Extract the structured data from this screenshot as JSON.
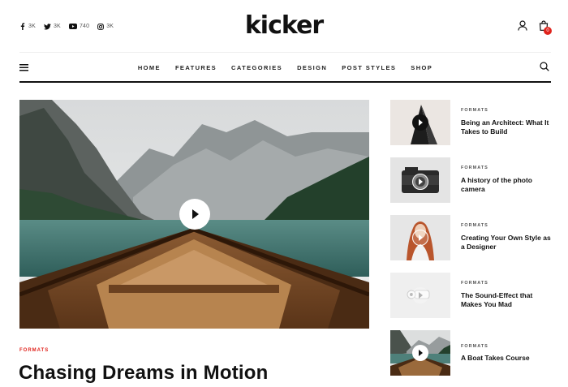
{
  "brand": {
    "logo": "kicker"
  },
  "social": [
    {
      "icon": "facebook-icon",
      "count": "3K"
    },
    {
      "icon": "twitter-icon",
      "count": "3K"
    },
    {
      "icon": "youtube-icon",
      "count": "740"
    },
    {
      "icon": "instagram-icon",
      "count": "3K"
    }
  ],
  "header": {
    "cart_count": "0"
  },
  "nav": {
    "items": [
      {
        "label": "HOME"
      },
      {
        "label": "FEATURES"
      },
      {
        "label": "CATEGORIES"
      },
      {
        "label": "DESIGN"
      },
      {
        "label": "POST STYLES"
      },
      {
        "label": "SHOP"
      }
    ]
  },
  "featured": {
    "category": "FORMATS",
    "title": "Chasing Dreams in Motion",
    "image": "mountain-lake-boat-photo",
    "media": "video"
  },
  "sidebar": {
    "posts": [
      {
        "category": "FORMATS",
        "title": "Being an Architect: What It Takes to Build",
        "thumb": "architecture-shape-photo"
      },
      {
        "category": "FORMATS",
        "title": "A history of the photo camera",
        "thumb": "vintage-camera-photo"
      },
      {
        "category": "FORMATS",
        "title": "Creating Your Own Style as a Designer",
        "thumb": "red-hair-woman-photo"
      },
      {
        "category": "FORMATS",
        "title": "The Sound-Effect that Makes You Mad",
        "thumb": "white-gadget-photo"
      },
      {
        "category": "FORMATS",
        "title": "A Boat Takes Course",
        "thumb": "mountain-lake-boat-photo"
      }
    ]
  }
}
